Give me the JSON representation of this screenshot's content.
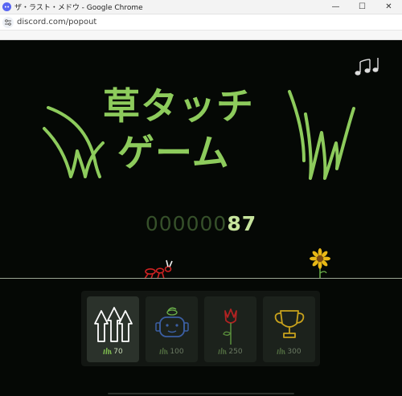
{
  "window": {
    "title": "ザ・ラスト・メドウ - Google Chrome",
    "url": "discord.com/popout",
    "minimize_glyph": "—",
    "maximize_glyph": "☐",
    "close_glyph": "✕"
  },
  "game": {
    "title_line1": "草タッチ",
    "title_line2": "ゲーム",
    "score_zeros": "000000",
    "score_value": "87"
  },
  "shop": {
    "items": [
      {
        "icon": "arrows-up-icon",
        "price": "70",
        "active": true
      },
      {
        "icon": "robot-face-icon",
        "price": "100",
        "active": false
      },
      {
        "icon": "rose-icon",
        "price": "250",
        "active": false
      },
      {
        "icon": "trophy-icon",
        "price": "300",
        "active": false
      }
    ]
  },
  "colors": {
    "accent": "#8dcb5c",
    "background": "#050805",
    "score_dim": "#36502a",
    "score_bright": "#c6e39c",
    "robot": "#3b5fa3",
    "rose": "#b22222",
    "trophy": "#c8a21c",
    "sunflower": "#e8b816"
  }
}
